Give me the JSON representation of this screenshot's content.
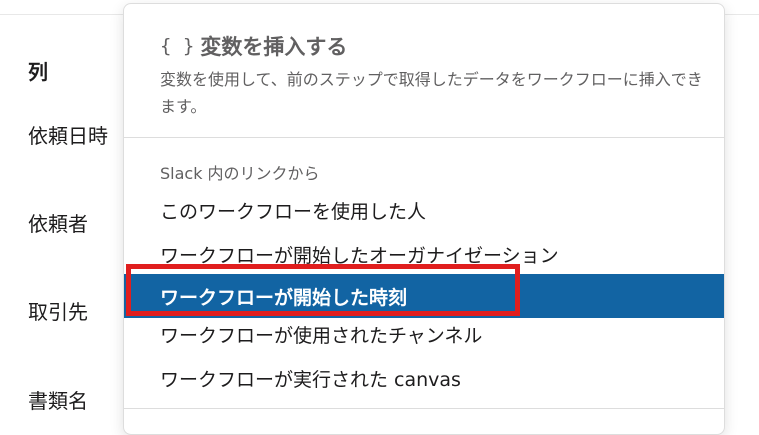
{
  "form": {
    "column_heading": "列",
    "fields": [
      "依頼日時",
      "依頼者",
      "取引先",
      "書類名"
    ]
  },
  "popover": {
    "title_icon": "{ }",
    "title": "変数を挿入する",
    "description": "変数を使用して、前のステップで取得したデータをワークフローに挿入できます。",
    "section_heading": "Slack 内のリンクから",
    "items": [
      {
        "label": "このワークフローを使用した人"
      },
      {
        "label": "ワークフローが開始したオーガナイゼーション"
      },
      {
        "label": "ワークフローが開始した時刻",
        "selected": true
      },
      {
        "label": "ワークフローが使用されたチャンネル"
      },
      {
        "label": "ワークフローが実行された canvas"
      }
    ]
  },
  "colors": {
    "selected_background": "#1264a3",
    "annotation_border": "#e01e1e",
    "muted_text": "#616061"
  },
  "icons": {
    "title_icon": "braces-icon"
  }
}
